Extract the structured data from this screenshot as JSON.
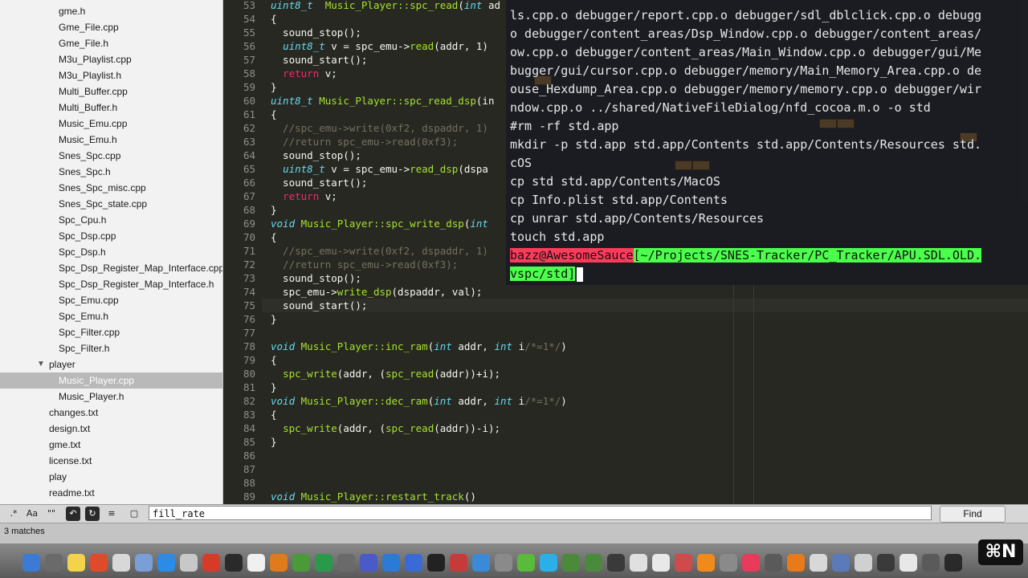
{
  "sidebar": {
    "items": [
      {
        "label": "gme.h",
        "indent": 73,
        "selected": false,
        "folder": false
      },
      {
        "label": "Gme_File.cpp",
        "indent": 73,
        "selected": false,
        "folder": false
      },
      {
        "label": "Gme_File.h",
        "indent": 73,
        "selected": false,
        "folder": false
      },
      {
        "label": "M3u_Playlist.cpp",
        "indent": 73,
        "selected": false,
        "folder": false
      },
      {
        "label": "M3u_Playlist.h",
        "indent": 73,
        "selected": false,
        "folder": false
      },
      {
        "label": "Multi_Buffer.cpp",
        "indent": 73,
        "selected": false,
        "folder": false
      },
      {
        "label": "Multi_Buffer.h",
        "indent": 73,
        "selected": false,
        "folder": false
      },
      {
        "label": "Music_Emu.cpp",
        "indent": 73,
        "selected": false,
        "folder": false
      },
      {
        "label": "Music_Emu.h",
        "indent": 73,
        "selected": false,
        "folder": false
      },
      {
        "label": "Snes_Spc.cpp",
        "indent": 73,
        "selected": false,
        "folder": false
      },
      {
        "label": "Snes_Spc.h",
        "indent": 73,
        "selected": false,
        "folder": false
      },
      {
        "label": "Snes_Spc_misc.cpp",
        "indent": 73,
        "selected": false,
        "folder": false
      },
      {
        "label": "Snes_Spc_state.cpp",
        "indent": 73,
        "selected": false,
        "folder": false
      },
      {
        "label": "Spc_Cpu.h",
        "indent": 73,
        "selected": false,
        "folder": false
      },
      {
        "label": "Spc_Dsp.cpp",
        "indent": 73,
        "selected": false,
        "folder": false
      },
      {
        "label": "Spc_Dsp.h",
        "indent": 73,
        "selected": false,
        "folder": false
      },
      {
        "label": "Spc_Dsp_Register_Map_Interface.cpp",
        "indent": 73,
        "selected": false,
        "folder": false
      },
      {
        "label": "Spc_Dsp_Register_Map_Interface.h",
        "indent": 73,
        "selected": false,
        "folder": false
      },
      {
        "label": "Spc_Emu.cpp",
        "indent": 73,
        "selected": false,
        "folder": false
      },
      {
        "label": "Spc_Emu.h",
        "indent": 73,
        "selected": false,
        "folder": false
      },
      {
        "label": "Spc_Filter.cpp",
        "indent": 73,
        "selected": false,
        "folder": false
      },
      {
        "label": "Spc_Filter.h",
        "indent": 73,
        "selected": false,
        "folder": false
      },
      {
        "label": "player",
        "indent": 61,
        "selected": false,
        "folder": true
      },
      {
        "label": "Music_Player.cpp",
        "indent": 73,
        "selected": true,
        "folder": false
      },
      {
        "label": "Music_Player.h",
        "indent": 73,
        "selected": false,
        "folder": false
      },
      {
        "label": "changes.txt",
        "indent": 61,
        "selected": false,
        "folder": false
      },
      {
        "label": "design.txt",
        "indent": 61,
        "selected": false,
        "folder": false
      },
      {
        "label": "gme.txt",
        "indent": 61,
        "selected": false,
        "folder": false
      },
      {
        "label": "license.txt",
        "indent": 61,
        "selected": false,
        "folder": false
      },
      {
        "label": "play",
        "indent": 61,
        "selected": false,
        "folder": false
      },
      {
        "label": "readme.txt",
        "indent": 61,
        "selected": false,
        "folder": false
      }
    ]
  },
  "editor": {
    "lines": [
      {
        "n": "53",
        "segs": [
          [
            "kt",
            "uint8_t"
          ],
          [
            "",
            "  "
          ],
          [
            "fn",
            "Music_Player::spc_read"
          ],
          [
            "",
            "("
          ],
          [
            "kt",
            "int"
          ],
          [
            "",
            " ad"
          ]
        ]
      },
      {
        "n": "54",
        "segs": [
          [
            "",
            "{"
          ]
        ]
      },
      {
        "n": "55",
        "segs": [
          [
            "",
            "  sound_stop();"
          ]
        ]
      },
      {
        "n": "56",
        "segs": [
          [
            "",
            "  "
          ],
          [
            "kt",
            "uint8_t"
          ],
          [
            "",
            " v = spc_emu->"
          ],
          [
            "fn",
            "read"
          ],
          [
            "",
            "(addr, 1)"
          ]
        ]
      },
      {
        "n": "57",
        "segs": [
          [
            "",
            "  sound_start();"
          ]
        ]
      },
      {
        "n": "58",
        "segs": [
          [
            "",
            "  "
          ],
          [
            "kw",
            "return"
          ],
          [
            "",
            " v;"
          ]
        ]
      },
      {
        "n": "59",
        "segs": [
          [
            "",
            "}"
          ]
        ]
      },
      {
        "n": "60",
        "segs": [
          [
            "kt",
            "uint8_t"
          ],
          [
            "",
            " "
          ],
          [
            "fn",
            "Music_Player::spc_read_dsp"
          ],
          [
            "",
            "(in"
          ]
        ]
      },
      {
        "n": "61",
        "segs": [
          [
            "",
            "{"
          ]
        ]
      },
      {
        "n": "62",
        "segs": [
          [
            "cm",
            "  //spc_emu->write(0xf2, dspaddr, 1)"
          ]
        ]
      },
      {
        "n": "63",
        "segs": [
          [
            "cm",
            "  //return spc_emu->read(0xf3);"
          ]
        ]
      },
      {
        "n": "64",
        "segs": [
          [
            "",
            "  sound_stop();"
          ]
        ]
      },
      {
        "n": "65",
        "segs": [
          [
            "",
            "  "
          ],
          [
            "kt",
            "uint8_t"
          ],
          [
            "",
            " v = spc_emu->"
          ],
          [
            "fn",
            "read_dsp"
          ],
          [
            "",
            "(dspa"
          ]
        ]
      },
      {
        "n": "66",
        "segs": [
          [
            "",
            "  sound_start();"
          ]
        ]
      },
      {
        "n": "67",
        "segs": [
          [
            "",
            "  "
          ],
          [
            "kw",
            "return"
          ],
          [
            "",
            " v;"
          ]
        ]
      },
      {
        "n": "68",
        "segs": [
          [
            "",
            "}"
          ]
        ]
      },
      {
        "n": "69",
        "segs": [
          [
            "kt",
            "void"
          ],
          [
            "",
            " "
          ],
          [
            "fn",
            "Music_Player::spc_write_dsp"
          ],
          [
            "",
            "("
          ],
          [
            "kt",
            "int"
          ]
        ]
      },
      {
        "n": "70",
        "segs": [
          [
            "",
            "{"
          ]
        ]
      },
      {
        "n": "71",
        "segs": [
          [
            "cm",
            "  //spc_emu->write(0xf2, dspaddr, 1)"
          ]
        ]
      },
      {
        "n": "72",
        "segs": [
          [
            "cm",
            "  //return spc_emu->read(0xf3);"
          ]
        ]
      },
      {
        "n": "73",
        "segs": [
          [
            "",
            "  sound_stop();"
          ]
        ]
      },
      {
        "n": "74",
        "segs": [
          [
            "",
            "  spc_emu->"
          ],
          [
            "fn",
            "write_dsp"
          ],
          [
            "",
            "(dspaddr, val);"
          ]
        ]
      },
      {
        "n": "75",
        "segs": [
          [
            "",
            "  sound_start();"
          ]
        ]
      },
      {
        "n": "76",
        "segs": [
          [
            "",
            "}"
          ]
        ]
      },
      {
        "n": "77",
        "segs": [
          [
            "",
            ""
          ]
        ]
      },
      {
        "n": "78",
        "segs": [
          [
            "kt",
            "void"
          ],
          [
            "",
            " "
          ],
          [
            "fn",
            "Music_Player::inc_ram"
          ],
          [
            "",
            "("
          ],
          [
            "kt",
            "int"
          ],
          [
            "",
            " addr, "
          ],
          [
            "kt",
            "int"
          ],
          [
            "",
            " i"
          ],
          [
            "cm",
            "/*=1*/"
          ],
          [
            "",
            ")"
          ]
        ]
      },
      {
        "n": "79",
        "segs": [
          [
            "",
            "{"
          ]
        ]
      },
      {
        "n": "80",
        "segs": [
          [
            "",
            "  "
          ],
          [
            "fn",
            "spc_write"
          ],
          [
            "",
            "(addr, ("
          ],
          [
            "fn",
            "spc_read"
          ],
          [
            "",
            "(addr))+i);"
          ]
        ]
      },
      {
        "n": "81",
        "segs": [
          [
            "",
            "}"
          ]
        ]
      },
      {
        "n": "82",
        "segs": [
          [
            "kt",
            "void"
          ],
          [
            "",
            " "
          ],
          [
            "fn",
            "Music_Player::dec_ram"
          ],
          [
            "",
            "("
          ],
          [
            "kt",
            "int"
          ],
          [
            "",
            " addr, "
          ],
          [
            "kt",
            "int"
          ],
          [
            "",
            " i"
          ],
          [
            "cm",
            "/*=1*/"
          ],
          [
            "",
            ")"
          ]
        ]
      },
      {
        "n": "83",
        "segs": [
          [
            "",
            "{"
          ]
        ]
      },
      {
        "n": "84",
        "segs": [
          [
            "",
            "  "
          ],
          [
            "fn",
            "spc_write"
          ],
          [
            "",
            "(addr, ("
          ],
          [
            "fn",
            "spc_read"
          ],
          [
            "",
            "(addr))-i);"
          ]
        ]
      },
      {
        "n": "85",
        "segs": [
          [
            "",
            "}"
          ]
        ]
      },
      {
        "n": "86",
        "segs": [
          [
            "",
            ""
          ]
        ]
      },
      {
        "n": "87",
        "segs": [
          [
            "",
            ""
          ]
        ]
      },
      {
        "n": "88",
        "segs": [
          [
            "",
            ""
          ]
        ]
      },
      {
        "n": "89",
        "segs": [
          [
            "kt",
            "void"
          ],
          [
            "",
            " "
          ],
          [
            "fn",
            "Music_Player::restart_track"
          ],
          [
            "",
            "()"
          ]
        ]
      }
    ],
    "current_line": "75"
  },
  "terminal": {
    "lines": [
      "ls.cpp.o debugger/report.cpp.o debugger/sdl_dblclick.cpp.o debugg",
      "o debugger/content_areas/Dsp_Window.cpp.o debugger/content_areas/",
      "ow.cpp.o debugger/content_areas/Main_Window.cpp.o debugger/gui/Me",
      "bugger/gui/cursor.cpp.o debugger/memory/Main_Memory_Area.cpp.o de",
      "ouse_Hexdump_Area.cpp.o debugger/memory/memory.cpp.o debugger/wir",
      "ndow.cpp.o ../shared/NativeFileDialog/nfd_cocoa.m.o -o std",
      "#rm -rf std.app",
      "mkdir -p std.app std.app/Contents std.app/Contents/Resources std.",
      "cOS",
      "cp std std.app/Contents/MacOS",
      "cp Info.plist std.app/Contents",
      "cp unrar std.app/Contents/Resources",
      "touch std.app"
    ],
    "prompt_user": "bazz@AwesomeSauce",
    "prompt_path_1": "[~/Projects/SNES-Tracker/PC_Tracker/APU.SDL.OLD.",
    "prompt_path_2": "vspc/std]"
  },
  "findbar": {
    "regex_label": ".*",
    "case_label": "Aa",
    "word_label": "\"\"",
    "find_value": "fill_rate",
    "find_button": "Find"
  },
  "status": {
    "matches": "3 matches"
  },
  "shortcut_overlay": "⌘N",
  "colors": {
    "editor_bg": "#272822",
    "keyword": "#f92672",
    "type": "#66d9ef",
    "function": "#a6e22e",
    "comment": "#75715e",
    "prompt_user_bg": "#ff3b5c",
    "prompt_path_bg": "#4cff4c"
  }
}
